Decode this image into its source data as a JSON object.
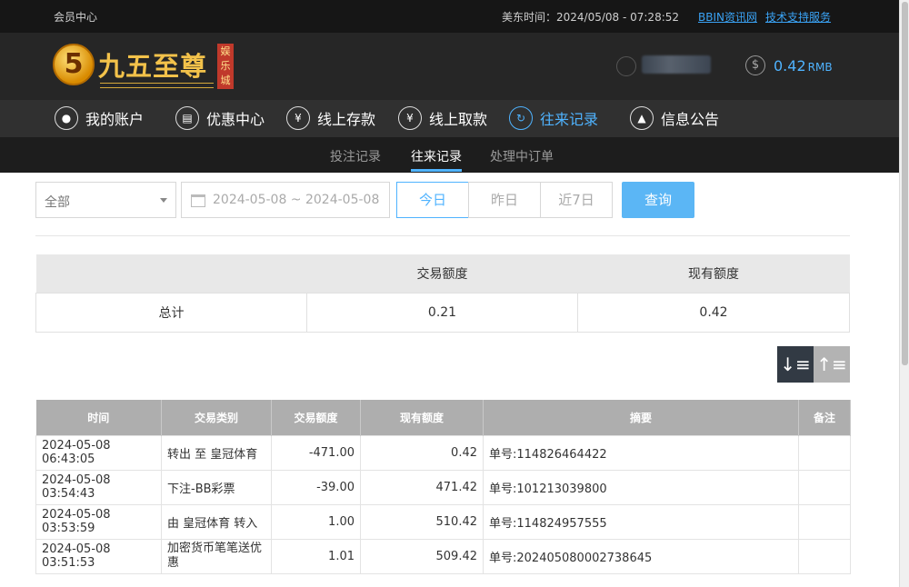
{
  "topbar": {
    "member_center": "会员中心",
    "time_label": "美东时间：2024/05/08 - 07:28:52",
    "links": [
      "BBIN资讯网",
      "技术支持服务"
    ]
  },
  "header": {
    "logo_text": "九五至尊",
    "logo_tag": "娱乐城",
    "logo_digit": "5",
    "balance": "0.42",
    "currency": "RMB"
  },
  "nav": [
    {
      "label": "我的账户",
      "icon": "user-icon"
    },
    {
      "label": "优惠中心",
      "icon": "gift-icon"
    },
    {
      "label": "线上存款",
      "icon": "deposit-icon"
    },
    {
      "label": "线上取款",
      "icon": "withdraw-icon"
    },
    {
      "label": "往来记录",
      "icon": "records-icon"
    },
    {
      "label": "信息公告",
      "icon": "bell-icon"
    }
  ],
  "subnav": [
    "投注记录",
    "往来记录",
    "处理中订单"
  ],
  "filters": {
    "type_selected": "全部",
    "date_range": "2024-05-08 ~ 2024-05-08",
    "quick": [
      "今日",
      "昨日",
      "近7日"
    ],
    "query": "查询"
  },
  "summary": {
    "headers": [
      "",
      "交易额度",
      "现有额度"
    ],
    "row": [
      "总计",
      "0.21",
      "0.42"
    ]
  },
  "detail": {
    "headers": [
      "时间",
      "交易类别",
      "交易额度",
      "现有额度",
      "摘要",
      "备注"
    ],
    "rows": [
      [
        "2024-05-08 06:43:05",
        "转出 至 皇冠体育",
        "-471.00",
        "0.42",
        "单号:114826464422",
        ""
      ],
      [
        "2024-05-08 03:54:43",
        "下注-BB彩票",
        "-39.00",
        "471.42",
        "单号:101213039800",
        ""
      ],
      [
        "2024-05-08 03:53:59",
        "由 皇冠体育 转入",
        "1.00",
        "510.42",
        "单号:114824957555",
        ""
      ],
      [
        "2024-05-08 03:51:53",
        "加密货币笔笔送优惠",
        "1.01",
        "509.42",
        "单号:202405080002738645",
        ""
      ]
    ]
  },
  "colors": {
    "accent": "#4fb3ff",
    "dark": "#262626",
    "nav": "#303030"
  }
}
